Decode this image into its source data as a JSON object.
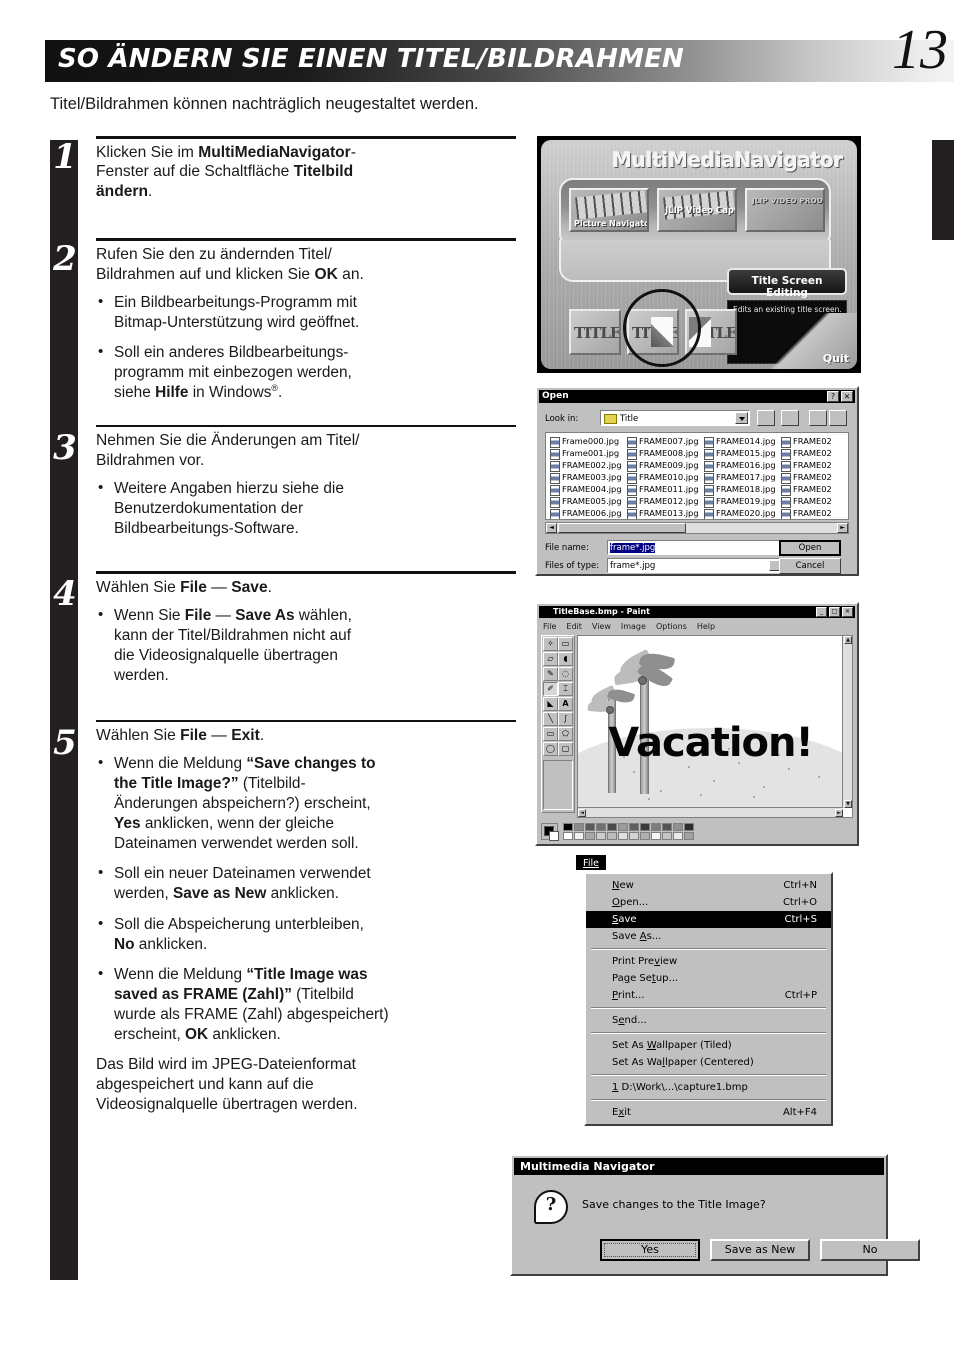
{
  "header": {
    "title": "SO ÄNDERN SIE EINEN TITEL/BILDRAHMEN",
    "page_number": "13",
    "intro": "Titel/Bildrahmen können nachträglich neugestaltet werden."
  },
  "steps": [
    {
      "num": "1",
      "lines": [
        "Klicken Sie im ",
        "MultiMediaNavigator",
        "-Fenster auf die Schaltfläche ",
        "Titelbild ändern",
        "."
      ],
      "bullets": []
    },
    {
      "num": "2",
      "lines": [
        "Rufen Sie den zu ändernden Titel/Bildrahmen auf und klicken Sie ",
        "OK",
        " an."
      ],
      "bullets": [
        "Ein Bildbearbeitungs-Programm mit Bitmap-Unterstützung wird geöffnet.",
        "Soll ein anderes Bildbearbeitungsprogramm mit einbezogen werden, siehe Hilfe in Windows®."
      ]
    },
    {
      "num": "3",
      "lines": [
        "Nehmen Sie die Änderungen am Titel/Bildrahmen vor."
      ],
      "bullets": [
        "Weitere Angaben hierzu siehe die Benutzerdokumentation der Bildbearbeitungs-Software."
      ]
    },
    {
      "num": "4",
      "lines": [
        "Wählen Sie ",
        "File",
        " — ",
        "Save",
        "."
      ],
      "bullets": [
        "Wenn Sie File — Save As wählen, kann der Titel/Bildrahmen nicht auf die Videosignalquelle übertragen werden."
      ]
    },
    {
      "num": "5",
      "lines": [
        "Wählen Sie ",
        "File",
        " — ",
        "Exit",
        "."
      ],
      "bullets": [
        "Wenn die Meldung “Save changes to the Title Image?” (Titelbild-Änderungen abspeichern?) erscheint, Yes anklicken, wenn der gleiche Dateinamen verwendet werden soll.",
        "Soll ein neuer Dateinamen verwendet werden, Save as New anklicken.",
        "Soll die Abspeicherung unterbleiben, No anklicken.",
        "Wenn die Meldung “Title Image was saved as FRAME (Zahl)” (Titelbild wurde als FRAME (Zahl) abgespeichert) erscheint, OK anklicken."
      ],
      "closing": "Das Bild wird im JPEG-Dateienformat abgespeichert und kann auf die Videosignalquelle übertragen werden."
    }
  ],
  "mmn": {
    "title": "MultiMediaNavigator",
    "apps": [
      "Picture Navigator",
      "JLIP Video Capture",
      "JLIP VIDEO PRODUCER"
    ],
    "title_screen_editing": "Title Screen Editing",
    "description": "Edits an existing title screen.",
    "quit": "Quit",
    "tiles": [
      "TITLE",
      "TITLE",
      "TITLE"
    ]
  },
  "open_dialog": {
    "title": "Open",
    "look_in_label": "Look in:",
    "look_in_value": "Title",
    "columns": [
      [
        "Frame000.jpg",
        "Frame001.jpg",
        "FRAME002.jpg",
        "FRAME003.jpg",
        "FRAME004.jpg",
        "FRAME005.jpg",
        "FRAME006.jpg"
      ],
      [
        "FRAME007.jpg",
        "FRAME008.jpg",
        "FRAME009.jpg",
        "FRAME010.jpg",
        "FRAME011.jpg",
        "FRAME012.jpg",
        "FRAME013.jpg"
      ],
      [
        "FRAME014.jpg",
        "FRAME015.jpg",
        "FRAME016.jpg",
        "FRAME017.jpg",
        "FRAME018.jpg",
        "FRAME019.jpg",
        "FRAME020.jpg"
      ],
      [
        "FRAME02",
        "FRAME02",
        "FRAME02",
        "FRAME02",
        "FRAME02",
        "FRAME02",
        "FRAME02"
      ]
    ],
    "file_name_label": "File name:",
    "file_name_value": "frame*.jpg",
    "file_type_label": "Files of type:",
    "file_type_value": "frame*.jpg",
    "open_button": "Open",
    "cancel_button": "Cancel"
  },
  "paint": {
    "title": "TitleBase.bmp - Paint",
    "menus": [
      "File",
      "Edit",
      "View",
      "Image",
      "Options",
      "Help"
    ],
    "canvas_text": "Vacation!"
  },
  "file_menu": {
    "button": "File",
    "items": [
      {
        "label": "New",
        "accel": "Ctrl+N",
        "highlighted": false
      },
      {
        "label": "Open...",
        "accel": "Ctrl+O",
        "highlighted": false
      },
      {
        "label": "Save",
        "accel": "Ctrl+S",
        "highlighted": true
      },
      {
        "label": "Save As...",
        "accel": "",
        "highlighted": false
      },
      {
        "sep": true
      },
      {
        "label": "Print Preview",
        "accel": "",
        "highlighted": false
      },
      {
        "label": "Page Setup...",
        "accel": "",
        "highlighted": false
      },
      {
        "label": "Print...",
        "accel": "Ctrl+P",
        "highlighted": false
      },
      {
        "sep": true
      },
      {
        "label": "Send...",
        "accel": "",
        "highlighted": false
      },
      {
        "sep": true
      },
      {
        "label": "Set As Wallpaper (Tiled)",
        "accel": "",
        "highlighted": false
      },
      {
        "label": "Set As Wallpaper (Centered)",
        "accel": "",
        "highlighted": false
      },
      {
        "sep": true
      },
      {
        "label": "1 D:\\Work\\...\\capture1.bmp",
        "accel": "",
        "highlighted": false
      },
      {
        "sep": true
      },
      {
        "label": "Exit",
        "accel": "Alt+F4",
        "highlighted": false
      }
    ]
  },
  "save_dialog": {
    "title": "Multimedia Navigator",
    "icon": "question-mark-icon",
    "message": "Save changes to the Title Image?",
    "buttons": [
      "Yes",
      "Save as New",
      "No"
    ]
  }
}
